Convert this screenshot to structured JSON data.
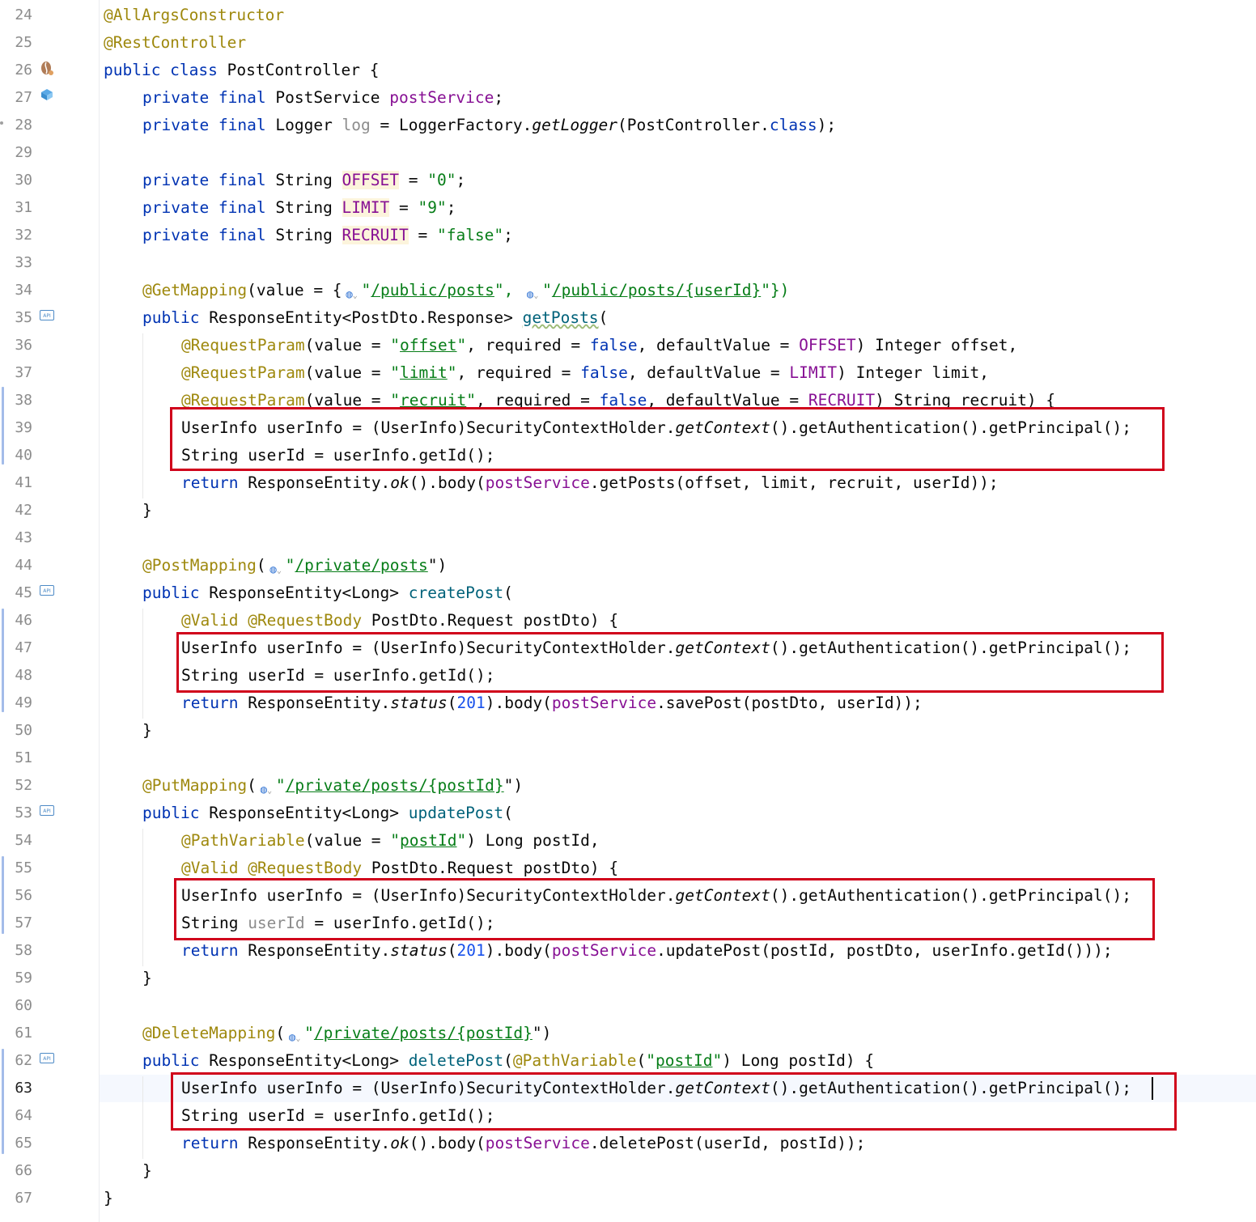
{
  "editor": {
    "file_name": "PostController.java",
    "current_line": 63,
    "line_numbers": [
      "24",
      "25",
      "26",
      "27",
      "28",
      "29",
      "30",
      "31",
      "32",
      "33",
      "34",
      "35",
      "36",
      "37",
      "38",
      "39",
      "40",
      "41",
      "42",
      "43",
      "44",
      "45",
      "46",
      "47",
      "48",
      "49",
      "50",
      "51",
      "52",
      "53",
      "54",
      "55",
      "56",
      "57",
      "58",
      "59",
      "60",
      "61",
      "62",
      "63",
      "64",
      "65",
      "66",
      "67"
    ],
    "gutter_icons": {
      "api_label": "API",
      "bean_icon": "spring-bean-icon",
      "inject_icon": "inject-icon",
      "endpoint_icon": "globe-endpoint-icon"
    },
    "highlight_color": "#d0021b",
    "code": {
      "l24": "@AllArgsConstructor",
      "l25": "@RestController",
      "l26": [
        "public class",
        " PostController {"
      ],
      "l27": [
        "private final",
        " PostService ",
        "postService",
        ";"
      ],
      "l28": [
        "private final",
        " Logger ",
        "log",
        " = LoggerFactory.",
        "getLogger",
        "(PostController.",
        "class",
        ");"
      ],
      "l30": [
        "private final",
        " String ",
        "OFFSET",
        " = ",
        "\"0\"",
        ";"
      ],
      "l31": [
        "private final",
        " String ",
        "LIMIT",
        " = ",
        "\"9\"",
        ";"
      ],
      "l32": [
        "private final",
        " String ",
        "RECRUIT",
        " = ",
        "\"false\"",
        ";"
      ],
      "l34": [
        "@GetMapping",
        "(value = {",
        "\"",
        "/public/posts",
        "\", ",
        "\"",
        "/public/posts/{userId}",
        "\"})"
      ],
      "l35": [
        "public",
        " ResponseEntity<PostDto.Response> ",
        "getPosts",
        "("
      ],
      "l36": [
        "@RequestParam",
        "(value = ",
        "\"",
        "offset",
        "\"",
        ", required = ",
        "false",
        ", defaultValue = ",
        "OFFSET",
        ") Integer offset,"
      ],
      "l37": [
        "@RequestParam",
        "(value = ",
        "\"",
        "limit",
        "\"",
        ", required = ",
        "false",
        ", defaultValue = ",
        "LIMIT",
        ") Integer limit,"
      ],
      "l38": [
        "@RequestParam",
        "(value = ",
        "\"",
        "recruit",
        "\"",
        ", required = ",
        "false",
        ", defaultValue = ",
        "RECRUIT",
        ") String recruit) {"
      ],
      "l_userinfo": [
        "UserInfo userInfo = (UserInfo)SecurityContextHolder.",
        "getContext",
        "().getAuthentication().getPrincipal();"
      ],
      "l_userid": [
        "String ",
        "userId",
        " = userInfo.getId();"
      ],
      "l41": [
        "return",
        " ResponseEntity.",
        "ok",
        "().body(",
        "postService",
        ".getPosts(offset, limit, recruit, userId));"
      ],
      "close_brace": "}",
      "l44": [
        "@PostMapping",
        "(",
        "\"",
        "/private/posts",
        "\")"
      ],
      "l45": [
        "public",
        " ResponseEntity<Long> ",
        "createPost",
        "("
      ],
      "l46": [
        "@Valid",
        " ",
        "@RequestBody",
        " PostDto.Request postDto) {"
      ],
      "l49": [
        "return",
        " ResponseEntity.",
        "status",
        "(",
        "201",
        ").body(",
        "postService",
        ".savePost(postDto, userId));"
      ],
      "l52": [
        "@PutMapping",
        "(",
        "\"",
        "/private/posts/{postId}",
        "\")"
      ],
      "l53": [
        "public",
        " ResponseEntity<Long> ",
        "updatePost",
        "("
      ],
      "l54": [
        "@PathVariable",
        "(value = ",
        "\"",
        "postId",
        "\"",
        ") Long postId,"
      ],
      "l55": [
        "@Valid",
        " ",
        "@RequestBody",
        " PostDto.Request postDto) {"
      ],
      "l58": [
        "return",
        " ResponseEntity.",
        "status",
        "(",
        "201",
        ").body(",
        "postService",
        ".updatePost(postId, postDto, userInfo.getId()));"
      ],
      "l61": [
        "@DeleteMapping",
        "(",
        "\"",
        "/private/posts/{postId}",
        "\")"
      ],
      "l62": [
        "public",
        " ResponseEntity<Long> ",
        "deletePost",
        "(",
        "@PathVariable",
        "(",
        "\"",
        "postId",
        "\"",
        ") Long postId) {"
      ],
      "l65": [
        "return",
        " ResponseEntity.",
        "ok",
        "().body(",
        "postService",
        ".deletePost(userId, postId));"
      ]
    }
  }
}
